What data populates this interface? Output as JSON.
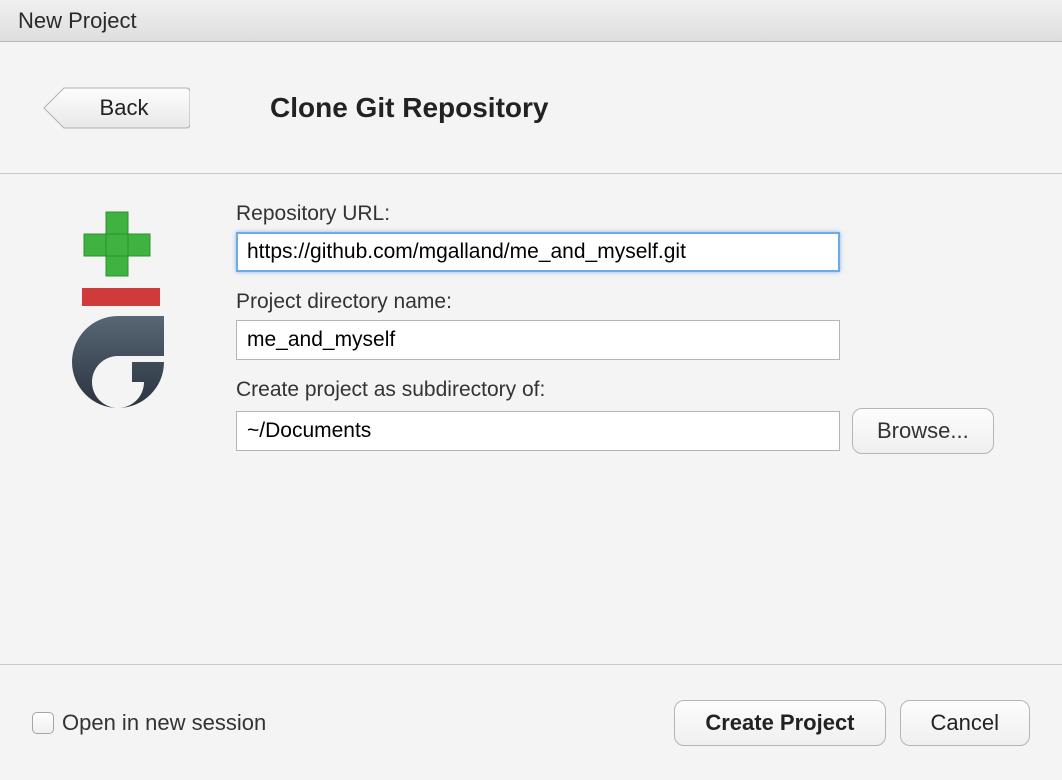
{
  "window": {
    "title": "New Project"
  },
  "header": {
    "back_label": "Back",
    "page_title": "Clone Git Repository"
  },
  "form": {
    "repo_url_label": "Repository URL:",
    "repo_url_value": "https://github.com/mgalland/me_and_myself.git",
    "project_dir_label": "Project directory name:",
    "project_dir_value": "me_and_myself",
    "subdir_label": "Create project as subdirectory of:",
    "subdir_value": "~/Documents",
    "browse_label": "Browse..."
  },
  "footer": {
    "open_new_session_label": "Open in new session",
    "open_new_session_checked": false,
    "create_label": "Create Project",
    "cancel_label": "Cancel"
  }
}
